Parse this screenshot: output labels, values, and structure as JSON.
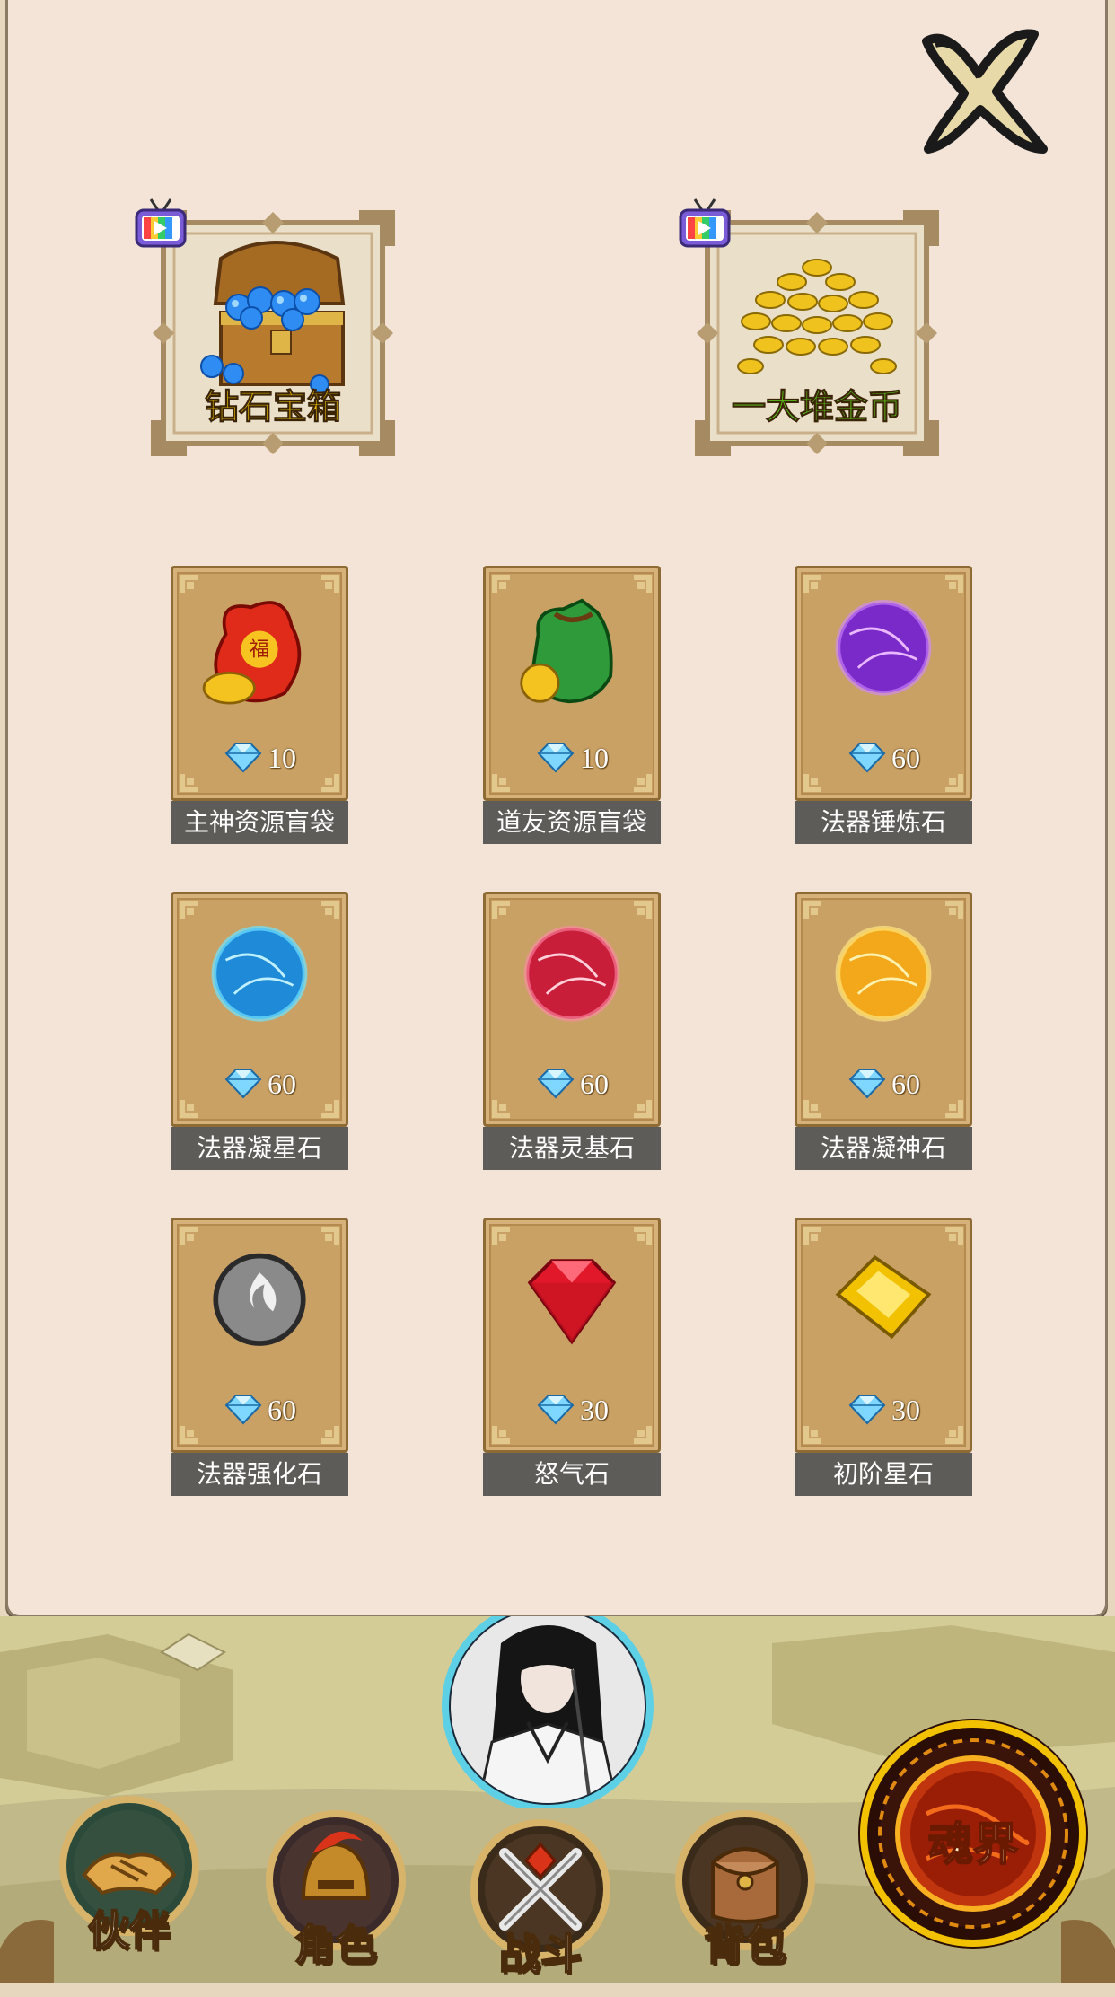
{
  "close": {
    "icon": "close-x-icon"
  },
  "rewards": [
    {
      "label": "钻石宝箱",
      "label_color": "#f2c200",
      "art": "diamond-chest-icon",
      "badge": "video-ad-tv-icon"
    },
    {
      "label": "一大堆金币",
      "label_color": "#5fd61e",
      "art": "gold-coin-pile-icon",
      "badge": "video-ad-tv-icon"
    }
  ],
  "items": [
    {
      "name": "主神资源盲袋",
      "price": "10",
      "icon": "red-lucky-bag-icon"
    },
    {
      "name": "道友资源盲袋",
      "price": "10",
      "icon": "green-coin-bag-icon"
    },
    {
      "name": "法器锤炼石",
      "price": "60",
      "icon": "purple-orb-icon"
    },
    {
      "name": "法器凝星石",
      "price": "60",
      "icon": "blue-orb-icon"
    },
    {
      "name": "法器灵基石",
      "price": "60",
      "icon": "red-orb-icon"
    },
    {
      "name": "法器凝神石",
      "price": "60",
      "icon": "gold-orb-icon"
    },
    {
      "name": "法器强化石",
      "price": "60",
      "icon": "grey-flame-orb-icon"
    },
    {
      "name": "怒气石",
      "price": "30",
      "icon": "red-gem-icon"
    },
    {
      "name": "初阶星石",
      "price": "30",
      "icon": "gold-gem-icon"
    }
  ],
  "currency_icon": "diamond-icon",
  "nav": [
    {
      "label": "伙伴",
      "icon": "handshake-icon"
    },
    {
      "label": "角色",
      "icon": "warrior-helmet-icon"
    },
    {
      "label": "战斗",
      "icon": "crossed-swords-icon"
    },
    {
      "label": "背包",
      "icon": "backpack-icon"
    }
  ],
  "soul_button": {
    "label": "魂界"
  },
  "hero_avatar": "hero-portrait-icon",
  "colors": {
    "panel": "#f3e4d7",
    "card": "#c9a165",
    "name_bar": "#5e5c58"
  }
}
